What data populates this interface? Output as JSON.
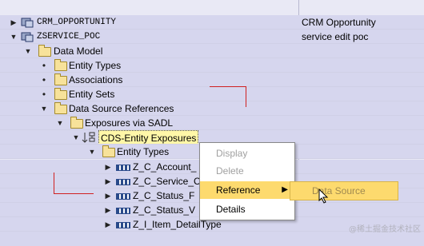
{
  "tree": {
    "rows": [
      {
        "label": "CRM_OPPORTUNITY",
        "description": "CRM Opportunity"
      },
      {
        "label": "ZSERVICE_POC",
        "description": "service edit poc"
      },
      {
        "label": "Data Model"
      },
      {
        "label": "Entity Types"
      },
      {
        "label": "Associations"
      },
      {
        "label": "Entity Sets"
      },
      {
        "label": "Data Source References"
      },
      {
        "label": "Exposures via SADL"
      },
      {
        "label": "CDS-Entity Exposures"
      },
      {
        "label": "Entity Types"
      },
      {
        "label": "Z_C_Account_"
      },
      {
        "label": "Z_C_Service_C"
      },
      {
        "label": "Z_C_Status_F"
      },
      {
        "label": "Z_C_Status_V"
      },
      {
        "label": "Z_I_Item_DetailType"
      }
    ]
  },
  "context_menu": {
    "items": [
      {
        "label": "Display",
        "enabled": false
      },
      {
        "label": "Delete",
        "enabled": false
      },
      {
        "label": "Reference",
        "enabled": true,
        "has_submenu": true
      },
      {
        "label": "Details",
        "enabled": true
      }
    ]
  },
  "submenu": {
    "items": [
      {
        "label": "Data Source",
        "enabled": false
      }
    ]
  },
  "watermark": "@稀土掘金技术社区",
  "colors": {
    "background": "#e9e9f5",
    "highlight_row": "#d6d6ee",
    "menu_hover": "#fdda6e",
    "selection": "#fff7a8",
    "annotation_red": "#d02020"
  }
}
